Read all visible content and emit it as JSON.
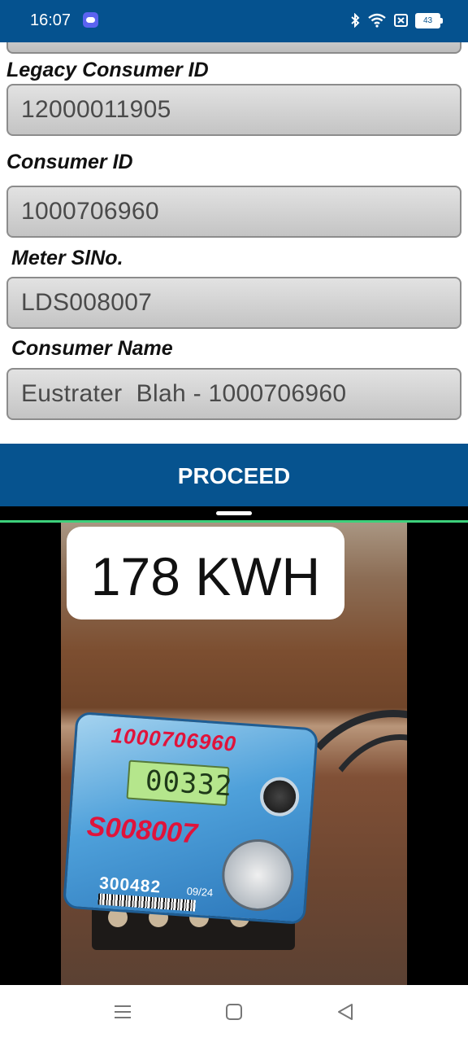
{
  "status_bar": {
    "time": "16:07",
    "battery_level": "43",
    "icons": [
      "app-notification-icon",
      "bluetooth-icon",
      "wifi-icon",
      "no-sim-icon",
      "battery-icon"
    ]
  },
  "form": {
    "fields": [
      {
        "label": "Legacy Consumer ID",
        "value": "12000011905"
      },
      {
        "label": "Consumer ID",
        "value": "1000706960"
      },
      {
        "label": "Meter SlNo.",
        "value": "LDS008007"
      },
      {
        "label": "Consumer Name",
        "value": "Eustrater  Blah - 1000706960"
      }
    ]
  },
  "actions": {
    "proceed_label": "PROCEED"
  },
  "photo": {
    "reading_label": "178 KWH",
    "meter_lcd": "00332",
    "meter_handwritten_top": "1000706960",
    "meter_handwritten_mid": "S008007",
    "meter_serial": "300482",
    "meter_date": "09/24"
  },
  "nav_bar": {
    "icons": [
      "menu-icon",
      "home-icon",
      "back-icon"
    ]
  },
  "colors": {
    "primary": "#05528f",
    "accent_green": "#3dd07b",
    "field_border": "#8c8c8c"
  }
}
